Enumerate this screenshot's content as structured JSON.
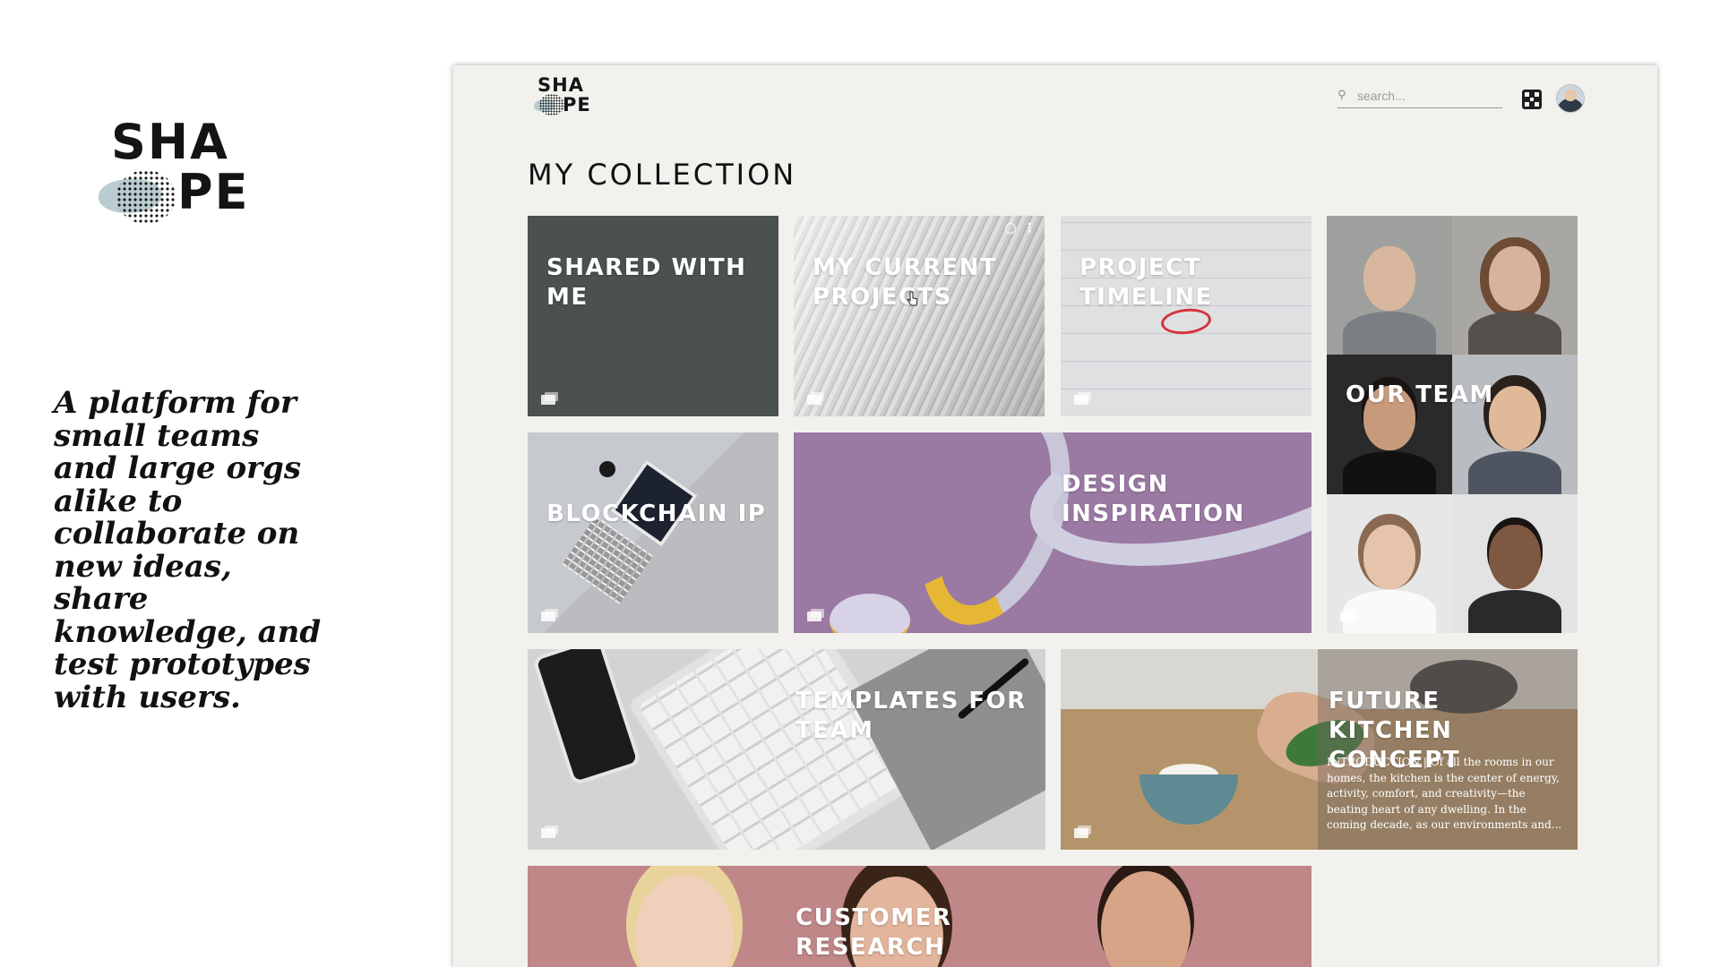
{
  "brand": {
    "logo_line1": "SHA",
    "logo_line2": "PE",
    "tagline": "A platform for small teams and large orgs alike to collaborate on new ideas, share knowledge, and test prototypes with users."
  },
  "header": {
    "logo_line1": "SHA",
    "logo_line2": "PE",
    "search_placeholder": "search...",
    "search_icon": "search-icon",
    "org_icon": "organization-icon",
    "avatar": "user-avatar"
  },
  "page": {
    "title": "MY COLLECTION"
  },
  "cards": {
    "shared": {
      "title": "SHARED WITH ME"
    },
    "current": {
      "title": "MY CURRENT PROJECTS"
    },
    "timeline": {
      "title": "PROJECT TIMELINE"
    },
    "team": {
      "title": "OUR TEAM"
    },
    "blockchain": {
      "title": "BLOCKCHAIN IP"
    },
    "design": {
      "title": "DESIGN INSPIRATION"
    },
    "templates": {
      "title": "TEMPLATES FOR TEAM"
    },
    "kitchen": {
      "title": "FUTURE KITCHEN CONCEPT",
      "description": "INTRODUCTION | Of all the rooms in our homes, the kitchen is the center of energy, activity, comfort, and creativity—the beating heart of any dwelling. In the coming decade, as our environments and..."
    },
    "research": {
      "title": "CUSTOMER RESEARCH"
    }
  },
  "colors": {
    "app_background": "#f2f1ee",
    "shared_card": "#4a5150",
    "design_card": "#9a79a3",
    "research_card": "#c08789",
    "timeline_mark": "#d6323e"
  }
}
